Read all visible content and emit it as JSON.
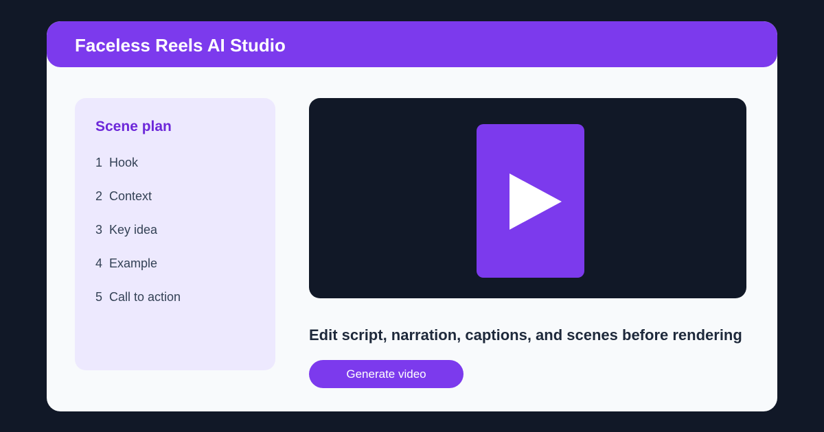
{
  "header": {
    "title": "Faceless Reels AI Studio"
  },
  "scene_plan": {
    "title": "Scene plan",
    "items": [
      {
        "number": "1",
        "label": "Hook"
      },
      {
        "number": "2",
        "label": "Context"
      },
      {
        "number": "3",
        "label": "Key idea"
      },
      {
        "number": "4",
        "label": "Example"
      },
      {
        "number": "5",
        "label": "Call to action"
      }
    ]
  },
  "preview": {
    "icon": "play-icon"
  },
  "main": {
    "caption": "Edit script, narration, captions, and scenes before rendering",
    "generate_label": "Generate video"
  },
  "colors": {
    "background": "#111827",
    "accent": "#7c3aed",
    "panel": "#ede9fe",
    "panel_title": "#6d28d9"
  }
}
